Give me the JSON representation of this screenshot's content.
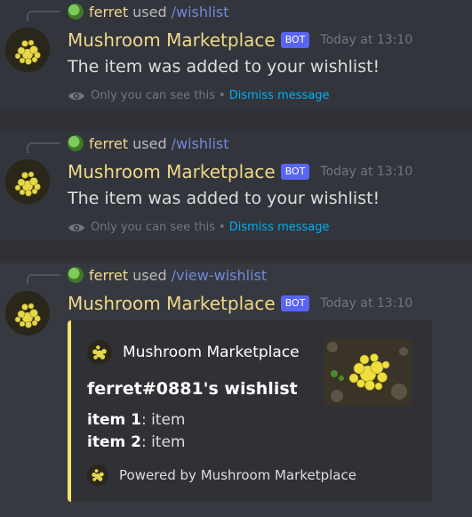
{
  "messages": [
    {
      "reply": {
        "user": "ferret",
        "used": "used",
        "command": "/wishlist"
      },
      "author": "Mushroom Marketplace",
      "bot_tag": "BOT",
      "timestamp": "Today at 13:10",
      "content": "The item was added to your wishlist!",
      "ephemeral": {
        "notice": "Only you can see this",
        "separator": "•",
        "dismiss": "Dismiss message"
      }
    },
    {
      "reply": {
        "user": "ferret",
        "used": "used",
        "command": "/wishlist"
      },
      "author": "Mushroom Marketplace",
      "bot_tag": "BOT",
      "timestamp": "Today at 13:10",
      "content": "The item was added to your wishlist!",
      "ephemeral": {
        "notice": "Only you can see this",
        "separator": "•",
        "dismiss": "Dismiss message"
      }
    },
    {
      "reply": {
        "user": "ferret",
        "used": "used",
        "command": "/view-wishlist"
      },
      "author": "Mushroom Marketplace",
      "bot_tag": "BOT",
      "timestamp": "Today at 13:10",
      "embed": {
        "author": "Mushroom Marketplace",
        "title": "ferret#0881's wishlist",
        "fields": [
          {
            "name": "item 1",
            "value": ": item"
          },
          {
            "name": "item 2",
            "value": ": item"
          }
        ],
        "footer": "Powered by Mushroom Marketplace",
        "accent_color": "#f5e56b"
      }
    }
  ],
  "icons": {
    "eye": "eye-icon",
    "avatar": "mushroom-avatar"
  }
}
